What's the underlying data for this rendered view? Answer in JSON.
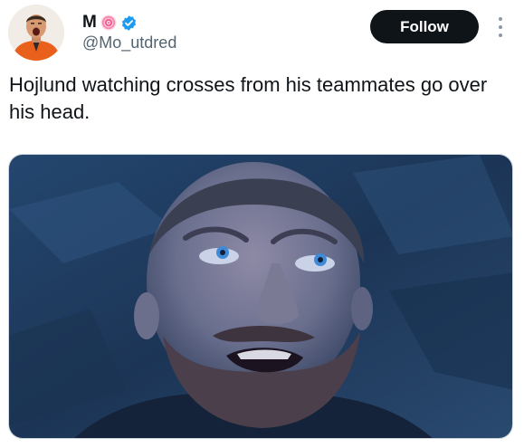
{
  "author": {
    "display_name": "M",
    "handle": "@Mo_utdred",
    "name_emoji_icon": "lollipop-swirl-emoji",
    "verified_icon": "blue-verified-badge-icon",
    "avatar_icon": "shouting-man-orange-jacket-avatar"
  },
  "actions": {
    "follow_label": "Follow",
    "more_icon": "vertical-ellipsis-icon"
  },
  "tweet": {
    "text": "Hojlund watching crosses from his teammates go over his head."
  },
  "media": {
    "description_icon": "man-looking-up-in-awe-photo"
  },
  "colors": {
    "follow_bg": "#0f1419",
    "verified": "#1d9bf0",
    "handle": "#536471",
    "media_tone": "#1f3a5a"
  }
}
